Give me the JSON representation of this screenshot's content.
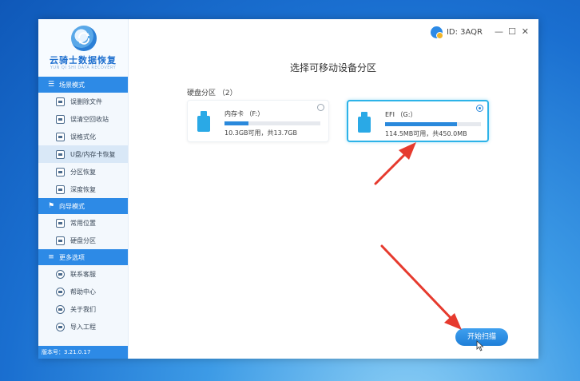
{
  "app": {
    "name": "云骑士数据恢复",
    "subtitle": "YUN QI SHI DATA RECOVERY",
    "version": "版本号：3.21.0.17"
  },
  "titlebar": {
    "id_text": "ID: 3AQR",
    "minimize": "—",
    "maximize": "☐",
    "close": "✕"
  },
  "sidebar": {
    "sections": [
      {
        "title": "场景模式",
        "items": [
          "误删除文件",
          "误清空回收站",
          "误格式化",
          "U盘/内存卡恢复",
          "分区恢复",
          "深度恢复"
        ]
      },
      {
        "title": "向导模式",
        "items": [
          "常用位置",
          "硬盘分区"
        ]
      },
      {
        "title": "更多选项",
        "items": [
          "联系客服",
          "帮助中心",
          "关于我们",
          "导入工程"
        ]
      }
    ],
    "active_item": "U盘/内存卡恢复"
  },
  "main": {
    "title": "选择可移动设备分区",
    "partition_label": "硬盘分区 （2）",
    "cards": [
      {
        "name": "内存卡 （F:）",
        "info": "10.3GB可用，共13.7GB",
        "used_fraction": 0.25,
        "selected": false
      },
      {
        "name": "EFI （G:）",
        "info": "114.5MB可用，共450.0MB",
        "used_fraction": 0.75,
        "selected": true
      }
    ],
    "start_button": "开始扫描"
  },
  "colors": {
    "accent": "#2d8ae6",
    "bar_fill": "#2a89dc",
    "selected_border": "#2db3e8",
    "annotation_arrow": "#e63a2e"
  }
}
